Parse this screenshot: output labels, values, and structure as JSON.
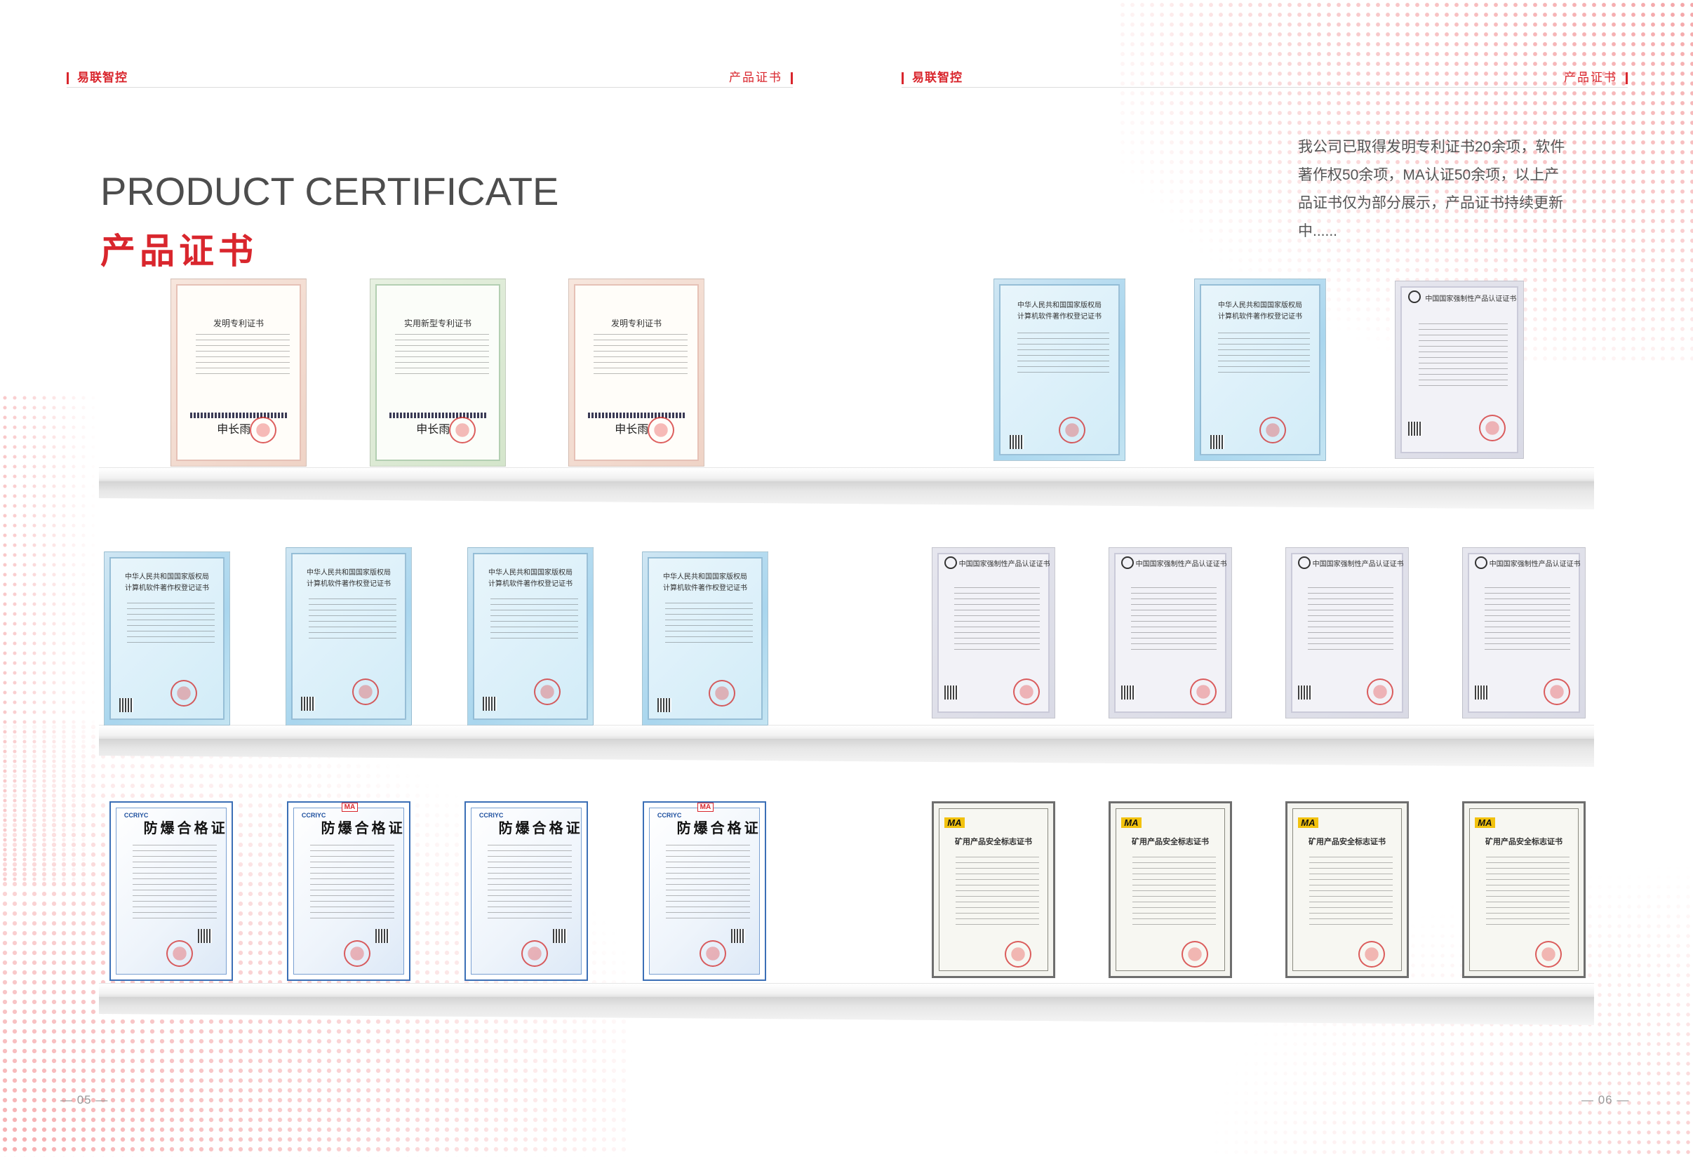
{
  "header": {
    "left": {
      "brand": "易联智控",
      "section": "产品证书"
    },
    "right": {
      "brand": "易联智控",
      "section": "产品证书"
    }
  },
  "titles": {
    "en": "PRODUCT CERTIFICATE",
    "cn": "产品证书"
  },
  "description": "我公司已取得发明专利证书20余项，软件著作权50余项，MA认证50余项，以上产品证书仅为部分展示，产品证书持续更新中......",
  "certificates": {
    "patent_invention": {
      "title": "发明专利证书",
      "sign": "申长雨"
    },
    "patent_utility": {
      "title": "实用新型专利证书",
      "sign": "申长雨"
    },
    "software": {
      "line1": "中华人民共和国国家版权局",
      "line2": "计算机软件著作权登记证书"
    },
    "ccc": {
      "title": "中国国家强制性产品认证证书"
    },
    "explosion": {
      "title": "防爆合格证",
      "logo": "CCRIYC",
      "ma_badge": "MA"
    },
    "mine": {
      "title": "矿用产品安全标志证书",
      "logo": "MA"
    }
  },
  "page_numbers": {
    "left": "— 05 —",
    "right": "— 06 —"
  },
  "colors": {
    "accent": "#d9262d",
    "text": "#4d4d4d"
  }
}
